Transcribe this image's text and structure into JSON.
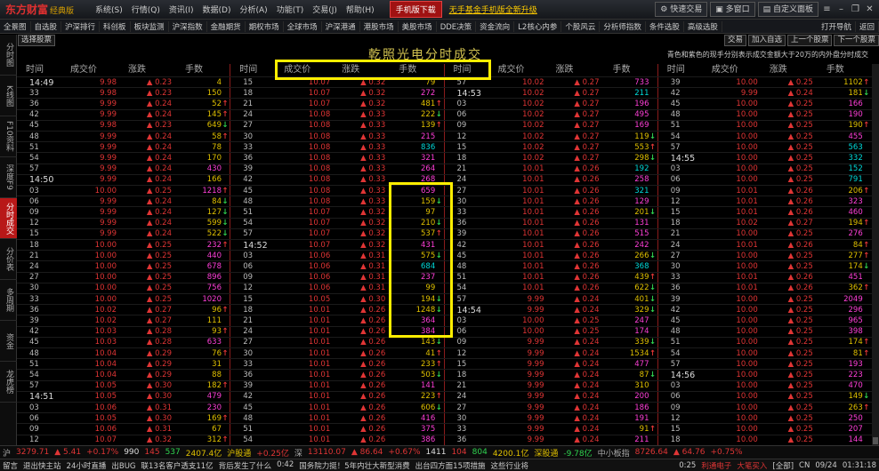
{
  "app": {
    "logo": "东方财富",
    "edition": "经典版",
    "menu": [
      "系统(S)",
      "行情(Q)",
      "资讯(I)",
      "数据(D)",
      "分析(A)",
      "功能(T)",
      "交易(J)",
      "帮助(H)"
    ],
    "mobile_label": "手机版下载",
    "upgrade_label": "无手基金手机版全新升级",
    "quick_trade": "快速交易",
    "multi_window": "多窗口",
    "custom_panel": "自定义面板"
  },
  "toolbar": {
    "items": [
      "全景图",
      "自选股",
      "沪深排行",
      "科创板",
      "板块监测",
      "沪深指数",
      "金融期货",
      "期权市场",
      "全球市场",
      "沪深港通",
      "港股市场",
      "美股市场",
      "DDE决策",
      "资金流向",
      "L2核心内参",
      "个股风云",
      "分析师指数",
      "条件选股",
      "高级选股"
    ],
    "right": [
      "打开导航",
      "返回"
    ]
  },
  "sidebar": {
    "items": [
      "分时图",
      "K线图",
      "F10资料",
      "深度F9",
      "分时成交",
      "分价表",
      "多周期",
      "资金",
      "龙虎榜"
    ],
    "active_index": 4
  },
  "subbar": {
    "select_stock": "选择股票",
    "buttons": [
      "交易",
      "加入自选",
      "上一个股票",
      "下一个股票"
    ]
  },
  "title": "乾照光电分时成交",
  "note": "青色和紫色的现手分别表示成交金额大于20万的内外盘分时成交",
  "headers": [
    "时间",
    "成交价",
    "涨跌",
    "手数"
  ],
  "colors": {
    "up": "#e03535",
    "down": "#2fd24f",
    "big_buy": "#ff3fd8",
    "big_sell": "#00d8d8",
    "normal": "#e0c000"
  },
  "columns": [
    [
      [
        "14:49",
        "9.98",
        "0.23",
        "4",
        "n",
        ""
      ],
      [
        "33",
        "9.98",
        "0.23",
        "150",
        "n",
        ""
      ],
      [
        "36",
        "9.99",
        "0.24",
        "52",
        "n",
        "u"
      ],
      [
        "42",
        "9.99",
        "0.24",
        "145",
        "n",
        "u"
      ],
      [
        "45",
        "9.98",
        "0.23",
        "649",
        "n",
        "d"
      ],
      [
        "48",
        "9.99",
        "0.24",
        "58",
        "n",
        "u"
      ],
      [
        "51",
        "9.99",
        "0.24",
        "78",
        "n",
        ""
      ],
      [
        "54",
        "9.99",
        "0.24",
        "170",
        "n",
        ""
      ],
      [
        "57",
        "9.99",
        "0.24",
        "430",
        "m",
        ""
      ],
      [
        "14:50",
        "9.99",
        "0.24",
        "166",
        "n",
        ""
      ],
      [
        "03",
        "10.00",
        "0.25",
        "1218",
        "m",
        "u"
      ],
      [
        "06",
        "9.99",
        "0.24",
        "84",
        "n",
        "d"
      ],
      [
        "09",
        "9.99",
        "0.24",
        "127",
        "n",
        "d"
      ],
      [
        "12",
        "9.99",
        "0.24",
        "599",
        "n",
        "d"
      ],
      [
        "15",
        "9.99",
        "0.24",
        "522",
        "n",
        "d"
      ],
      [
        "18",
        "10.00",
        "0.25",
        "232",
        "m",
        "u"
      ],
      [
        "21",
        "10.00",
        "0.25",
        "440",
        "m",
        ""
      ],
      [
        "24",
        "10.00",
        "0.25",
        "678",
        "m",
        ""
      ],
      [
        "27",
        "10.00",
        "0.25",
        "896",
        "m",
        ""
      ],
      [
        "30",
        "10.00",
        "0.25",
        "756",
        "m",
        ""
      ],
      [
        "33",
        "10.00",
        "0.25",
        "1020",
        "m",
        ""
      ],
      [
        "36",
        "10.02",
        "0.27",
        "96",
        "n",
        "u"
      ],
      [
        "39",
        "10.02",
        "0.27",
        "111",
        "n",
        ""
      ],
      [
        "42",
        "10.03",
        "0.28",
        "93",
        "n",
        "u"
      ],
      [
        "45",
        "10.03",
        "0.28",
        "633",
        "m",
        ""
      ],
      [
        "48",
        "10.04",
        "0.29",
        "76",
        "n",
        "u"
      ],
      [
        "51",
        "10.04",
        "0.29",
        "31",
        "n",
        ""
      ],
      [
        "54",
        "10.04",
        "0.29",
        "88",
        "n",
        ""
      ],
      [
        "57",
        "10.05",
        "0.30",
        "182",
        "n",
        "u"
      ],
      [
        "14:51",
        "10.05",
        "0.30",
        "479",
        "m",
        ""
      ],
      [
        "03",
        "10.06",
        "0.31",
        "230",
        "m",
        ""
      ],
      [
        "06",
        "10.05",
        "0.30",
        "169",
        "n",
        "u"
      ],
      [
        "09",
        "10.06",
        "0.31",
        "67",
        "n",
        ""
      ],
      [
        "12",
        "10.07",
        "0.32",
        "312",
        "n",
        "u"
      ]
    ],
    [
      [
        "15",
        "10.07",
        "0.32",
        "79",
        "n",
        ""
      ],
      [
        "18",
        "10.07",
        "0.32",
        "272",
        "m",
        ""
      ],
      [
        "21",
        "10.07",
        "0.32",
        "481",
        "n",
        "u"
      ],
      [
        "24",
        "10.08",
        "0.33",
        "222",
        "n",
        "d"
      ],
      [
        "27",
        "10.08",
        "0.33",
        "139",
        "n",
        "u"
      ],
      [
        "30",
        "10.08",
        "0.33",
        "215",
        "m",
        ""
      ],
      [
        "33",
        "10.08",
        "0.33",
        "836",
        "c",
        ""
      ],
      [
        "36",
        "10.08",
        "0.33",
        "321",
        "m",
        ""
      ],
      [
        "39",
        "10.08",
        "0.33",
        "264",
        "m",
        ""
      ],
      [
        "42",
        "10.08",
        "0.33",
        "268",
        "m",
        ""
      ],
      [
        "45",
        "10.08",
        "0.33",
        "659",
        "m",
        ""
      ],
      [
        "48",
        "10.08",
        "0.33",
        "159",
        "n",
        "d"
      ],
      [
        "51",
        "10.07",
        "0.32",
        "97",
        "n",
        ""
      ],
      [
        "54",
        "10.07",
        "0.32",
        "210",
        "n",
        "d"
      ],
      [
        "57",
        "10.07",
        "0.32",
        "537",
        "n",
        "u"
      ],
      [
        "14:52",
        "10.07",
        "0.32",
        "431",
        "m",
        ""
      ],
      [
        "03",
        "10.06",
        "0.31",
        "575",
        "n",
        "d"
      ],
      [
        "06",
        "10.06",
        "0.31",
        "684",
        "c",
        ""
      ],
      [
        "09",
        "10.06",
        "0.31",
        "237",
        "m",
        ""
      ],
      [
        "12",
        "10.06",
        "0.31",
        "99",
        "n",
        ""
      ],
      [
        "15",
        "10.05",
        "0.30",
        "194",
        "n",
        "d"
      ],
      [
        "18",
        "10.01",
        "0.26",
        "1248",
        "n",
        "d"
      ],
      [
        "21",
        "10.01",
        "0.26",
        "364",
        "m",
        ""
      ],
      [
        "24",
        "10.01",
        "0.26",
        "384",
        "m",
        ""
      ],
      [
        "27",
        "10.01",
        "0.26",
        "143",
        "n",
        "d"
      ],
      [
        "30",
        "10.01",
        "0.26",
        "41",
        "n",
        "u"
      ],
      [
        "33",
        "10.01",
        "0.26",
        "233",
        "n",
        "u"
      ],
      [
        "36",
        "10.01",
        "0.26",
        "503",
        "n",
        "d"
      ],
      [
        "39",
        "10.01",
        "0.26",
        "141",
        "m",
        ""
      ],
      [
        "42",
        "10.01",
        "0.26",
        "223",
        "n",
        "u"
      ],
      [
        "45",
        "10.01",
        "0.26",
        "606",
        "n",
        "d"
      ],
      [
        "48",
        "10.01",
        "0.26",
        "416",
        "m",
        ""
      ],
      [
        "51",
        "10.01",
        "0.26",
        "375",
        "m",
        ""
      ],
      [
        "54",
        "10.01",
        "0.26",
        "386",
        "m",
        ""
      ]
    ],
    [
      [
        "57",
        "10.02",
        "0.27",
        "733",
        "m",
        ""
      ],
      [
        "14:53",
        "10.02",
        "0.27",
        "211",
        "c",
        ""
      ],
      [
        "03",
        "10.02",
        "0.27",
        "196",
        "m",
        ""
      ],
      [
        "06",
        "10.02",
        "0.27",
        "495",
        "m",
        ""
      ],
      [
        "09",
        "10.02",
        "0.27",
        "169",
        "m",
        ""
      ],
      [
        "12",
        "10.02",
        "0.27",
        "119",
        "n",
        "d"
      ],
      [
        "15",
        "10.02",
        "0.27",
        "553",
        "n",
        "u"
      ],
      [
        "18",
        "10.02",
        "0.27",
        "298",
        "n",
        "d"
      ],
      [
        "21",
        "10.01",
        "0.26",
        "192",
        "c",
        ""
      ],
      [
        "24",
        "10.01",
        "0.26",
        "258",
        "m",
        ""
      ],
      [
        "27",
        "10.01",
        "0.26",
        "321",
        "c",
        ""
      ],
      [
        "30",
        "10.01",
        "0.26",
        "129",
        "m",
        ""
      ],
      [
        "33",
        "10.01",
        "0.26",
        "201",
        "n",
        "d"
      ],
      [
        "36",
        "10.01",
        "0.26",
        "131",
        "m",
        ""
      ],
      [
        "39",
        "10.01",
        "0.26",
        "515",
        "m",
        ""
      ],
      [
        "42",
        "10.01",
        "0.26",
        "242",
        "m",
        ""
      ],
      [
        "45",
        "10.01",
        "0.26",
        "266",
        "n",
        "d"
      ],
      [
        "48",
        "10.01",
        "0.26",
        "368",
        "c",
        ""
      ],
      [
        "51",
        "10.01",
        "0.26",
        "439",
        "n",
        "u"
      ],
      [
        "54",
        "10.01",
        "0.26",
        "622",
        "n",
        "d"
      ],
      [
        "57",
        "9.99",
        "0.24",
        "401",
        "n",
        "d"
      ],
      [
        "14:54",
        "9.99",
        "0.24",
        "329",
        "n",
        "d"
      ],
      [
        "03",
        "10.00",
        "0.25",
        "247",
        "m",
        ""
      ],
      [
        "06",
        "10.00",
        "0.25",
        "174",
        "m",
        ""
      ],
      [
        "09",
        "9.99",
        "0.24",
        "339",
        "n",
        "d"
      ],
      [
        "12",
        "9.99",
        "0.24",
        "1534",
        "n",
        "u"
      ],
      [
        "15",
        "9.99",
        "0.24",
        "477",
        "m",
        ""
      ],
      [
        "18",
        "9.99",
        "0.24",
        "87",
        "n",
        "d"
      ],
      [
        "21",
        "9.99",
        "0.24",
        "310",
        "n",
        ""
      ],
      [
        "24",
        "9.99",
        "0.24",
        "200",
        "m",
        ""
      ],
      [
        "27",
        "9.99",
        "0.24",
        "186",
        "m",
        ""
      ],
      [
        "30",
        "9.99",
        "0.24",
        "191",
        "m",
        ""
      ],
      [
        "33",
        "9.99",
        "0.24",
        "91",
        "n",
        "u"
      ],
      [
        "36",
        "9.99",
        "0.24",
        "211",
        "m",
        ""
      ]
    ],
    [
      [
        "39",
        "10.00",
        "0.25",
        "1102",
        "n",
        "u"
      ],
      [
        "42",
        "9.99",
        "0.24",
        "181",
        "n",
        "d"
      ],
      [
        "45",
        "10.00",
        "0.25",
        "166",
        "m",
        ""
      ],
      [
        "48",
        "10.00",
        "0.25",
        "190",
        "m",
        ""
      ],
      [
        "51",
        "10.00",
        "0.25",
        "190",
        "n",
        "u"
      ],
      [
        "54",
        "10.00",
        "0.25",
        "455",
        "m",
        ""
      ],
      [
        "57",
        "10.00",
        "0.25",
        "563",
        "c",
        ""
      ],
      [
        "14:55",
        "10.00",
        "0.25",
        "332",
        "c",
        ""
      ],
      [
        "03",
        "10.00",
        "0.25",
        "152",
        "c",
        ""
      ],
      [
        "06",
        "10.00",
        "0.25",
        "791",
        "c",
        ""
      ],
      [
        "09",
        "10.01",
        "0.26",
        "206",
        "n",
        "u"
      ],
      [
        "12",
        "10.01",
        "0.26",
        "323",
        "m",
        ""
      ],
      [
        "15",
        "10.01",
        "0.26",
        "460",
        "m",
        ""
      ],
      [
        "18",
        "10.02",
        "0.27",
        "194",
        "n",
        "u"
      ],
      [
        "21",
        "10.00",
        "0.25",
        "276",
        "m",
        ""
      ],
      [
        "24",
        "10.01",
        "0.26",
        "84",
        "n",
        "u"
      ],
      [
        "27",
        "10.00",
        "0.25",
        "277",
        "n",
        "u"
      ],
      [
        "30",
        "10.00",
        "0.25",
        "174",
        "n",
        "d"
      ],
      [
        "33",
        "10.01",
        "0.26",
        "451",
        "m",
        ""
      ],
      [
        "36",
        "10.01",
        "0.26",
        "362",
        "n",
        "u"
      ],
      [
        "39",
        "10.00",
        "0.25",
        "2049",
        "m",
        ""
      ],
      [
        "42",
        "10.00",
        "0.25",
        "296",
        "m",
        ""
      ],
      [
        "45",
        "10.00",
        "0.25",
        "965",
        "m",
        ""
      ],
      [
        "48",
        "10.00",
        "0.25",
        "398",
        "m",
        ""
      ],
      [
        "51",
        "10.00",
        "0.25",
        "174",
        "n",
        "u"
      ],
      [
        "54",
        "10.00",
        "0.25",
        "81",
        "n",
        "u"
      ],
      [
        "57",
        "10.00",
        "0.25",
        "193",
        "m",
        ""
      ],
      [
        "14:56",
        "10.00",
        "0.25",
        "223",
        "m",
        ""
      ],
      [
        "03",
        "10.00",
        "0.25",
        "470",
        "m",
        ""
      ],
      [
        "06",
        "10.00",
        "0.25",
        "149",
        "n",
        "d"
      ],
      [
        "09",
        "10.00",
        "0.25",
        "263",
        "n",
        "u"
      ],
      [
        "12",
        "10.00",
        "0.25",
        "250",
        "m",
        ""
      ],
      [
        "15",
        "10.00",
        "0.25",
        "207",
        "m",
        ""
      ],
      [
        "18",
        "10.00",
        "0.25",
        "144",
        "m",
        ""
      ]
    ]
  ],
  "index_bar": [
    [
      "沪",
      "gry"
    ],
    [
      "3279.71",
      "red"
    ],
    [
      "▲ 5.41",
      "red"
    ],
    [
      "+0.17%",
      "red"
    ],
    [
      "990",
      "wht"
    ],
    [
      "145",
      "red"
    ],
    [
      "537",
      "green"
    ],
    [
      "2407.4亿",
      "yel"
    ],
    [
      "沪股通",
      "yel"
    ],
    [
      "+0.25亿",
      "red"
    ],
    [
      "深",
      "gry"
    ],
    [
      "13110.07",
      "red"
    ],
    [
      "▲ 86.64",
      "red"
    ],
    [
      "+0.67%",
      "red"
    ],
    [
      "1411",
      "wht"
    ],
    [
      "104",
      "red"
    ],
    [
      "804",
      "green"
    ],
    [
      "4200.1亿",
      "yel"
    ],
    [
      "深股通",
      "yel"
    ],
    [
      "-9.78亿",
      "green"
    ],
    [
      "中小板指",
      "gry"
    ],
    [
      "8726.64",
      "red"
    ],
    [
      "▲ 64.76",
      "red"
    ],
    [
      "+0.75%",
      "red"
    ]
  ],
  "news_bar": {
    "items": [
      "留言",
      "退出快主站",
      "24小时直播",
      "出BUG",
      "联13名客户透支11亿",
      "背后发生了什么",
      "0:42",
      "国务院力挺！5年内壮大新型消费",
      "出台四方面15项措施",
      "这些行业将"
    ],
    "right": [
      "0:25",
      "利通电子",
      "大笔买入",
      "[全部]",
      "CN",
      "09/24",
      "01:31:18"
    ]
  }
}
